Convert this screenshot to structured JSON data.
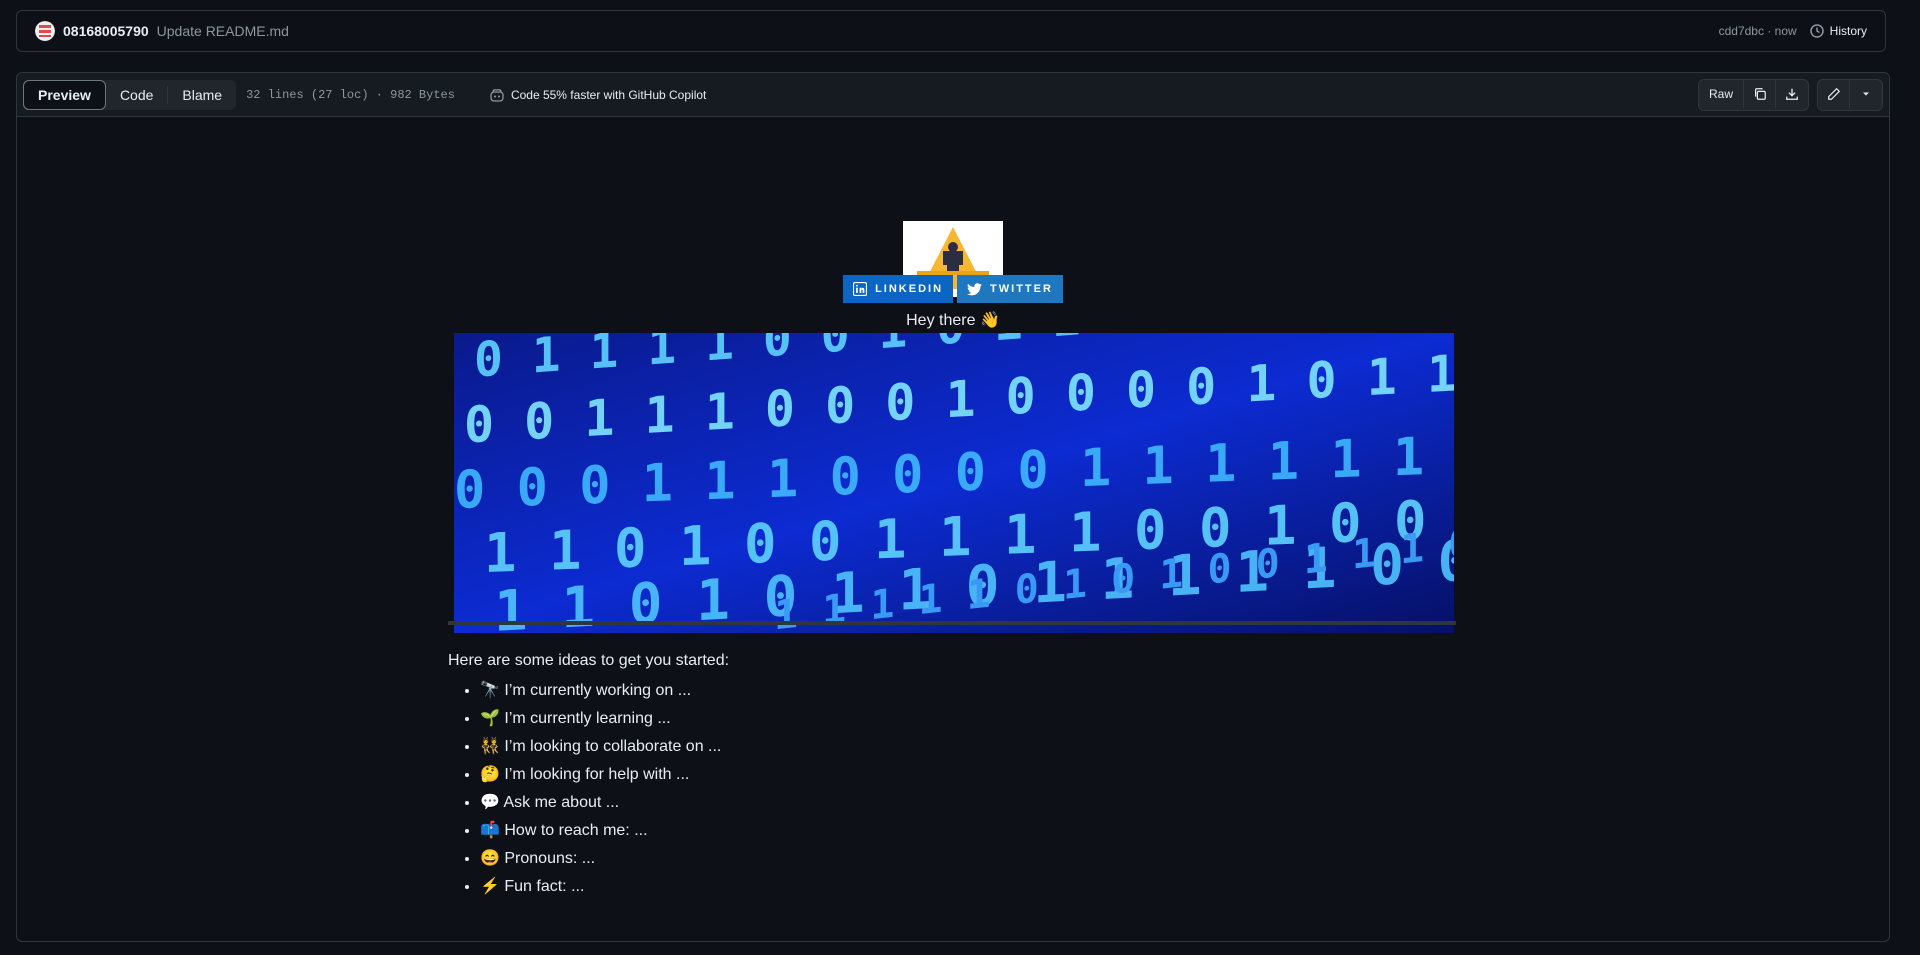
{
  "commit": {
    "author": "08168005790",
    "message": "Update README.md",
    "hash_time": "cdd7dbc · now",
    "history_label": "History"
  },
  "file_header": {
    "tabs": [
      "Preview",
      "Code",
      "Blame"
    ],
    "meta": "32 lines (27 loc) · 982 Bytes",
    "copilot": "Code 55% faster with GitHub Copilot",
    "raw_label": "Raw"
  },
  "readme": {
    "badges": {
      "linkedin": "LINKEDIN",
      "twitter": "TWITTER"
    },
    "greeting": "Hey there 👋",
    "intro": "Here are some ideas to get you started:",
    "ideas": [
      "🔭 I’m currently working on ...",
      "🌱 I’m currently learning ...",
      "👯 I’m looking to collaborate on ...",
      "🤔 I’m looking for help with ...",
      "💬 Ask me about ...",
      "📫 How to reach me: ...",
      "😄 Pronouns: ...",
      "⚡ Fun fact: ..."
    ]
  },
  "colors": {
    "background": "#0d1117",
    "header": "#161b22",
    "border": "#30363d",
    "linkedin": "#0a66c2",
    "twitter": "#1d78c1"
  }
}
